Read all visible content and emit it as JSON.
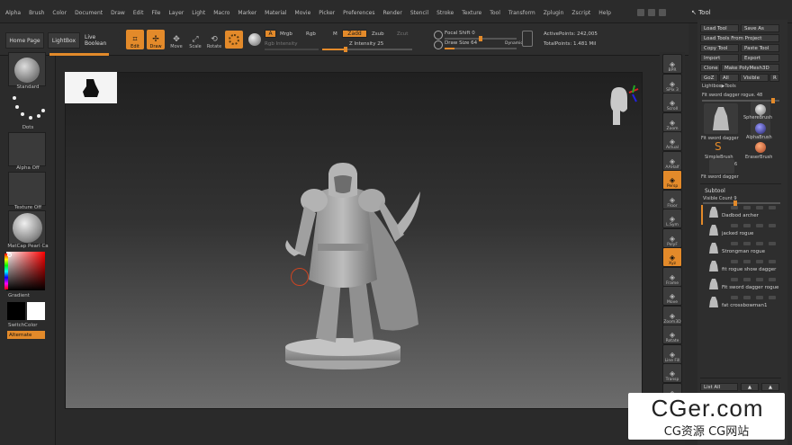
{
  "menu": {
    "items": [
      "Alpha",
      "Brush",
      "Color",
      "Document",
      "Draw",
      "Edit",
      "File",
      "Layer",
      "Light",
      "Macro",
      "Marker",
      "Material",
      "Movie",
      "Picker",
      "Preferences",
      "Render",
      "Stencil",
      "Stroke",
      "Texture",
      "Tool",
      "Transform",
      "Zplugin",
      "Zscript",
      "Help"
    ]
  },
  "tool_palette_title": "Tool",
  "shelf": {
    "home_page": "Home Page",
    "lightbox": "LightBox",
    "live_boolean": "Live Boolean",
    "edit": "Edit",
    "draw": "Draw",
    "move": "Move",
    "scale": "Scale",
    "rotate": "Rotate",
    "a_label": "A",
    "mrgb": "Mrgb",
    "rgb": "Rgb",
    "m": "M",
    "zadd": "Zadd",
    "zsub": "Zsub",
    "zcut": "Zcut",
    "rgb_intensity": "Rgb Intensity",
    "z_intensity": "Z Intensity 25",
    "z_intensity_value": 0.25,
    "focal_shift": "Focal Shift 0",
    "draw_size": "Draw Size 64",
    "dynamic": "Dynamic",
    "active_points": "ActivePoints: 242,005",
    "total_points": "TotalPoints: 1.481 Mil"
  },
  "left_tray": {
    "standard": "Standard",
    "dots": "Dots",
    "alpha_off": "Alpha Off",
    "texture_off": "Texture Off",
    "matcap": "MatCap Pearl Ca",
    "gradient": "Gradient",
    "switch_color": "SwitchColor",
    "alternate": "Alternate"
  },
  "right_shelf": [
    "BPR",
    "SPix 3",
    "Scroll",
    "Zoom",
    "Actual",
    "AAHalf",
    "Persp",
    "Floor",
    "L.Sym",
    "PolyF",
    "Xyz",
    "Frame",
    "Move",
    "Zoom3D",
    "Rotate",
    "Line Fill",
    "Transp",
    "Solo"
  ],
  "tool_panel": {
    "load_tool": "Load Tool",
    "save_as": "Save As",
    "load_from_project": "Load Tools From Project",
    "copy_tool": "Copy Tool",
    "paste_tool": "Paste Tool",
    "import": "Import",
    "export": "Export",
    "clone": "Clone",
    "make_polymesh": "Make PolyMesh3D",
    "goz": "GoZ",
    "all": "All",
    "visible": "Visible",
    "visible_r": "R",
    "lightbox_tools": "Lightbox▶Tools",
    "current_tool": "Fit sword dagger rogue. 48",
    "thumb_labels": [
      "Fit sword dagger",
      "SphereBrush",
      "AlphaBrush",
      "SimpleBrush",
      "EraserBrush",
      "Fit sword dagger"
    ],
    "thumb_count": "6",
    "subtool_header": "Subtool",
    "visible_count": "Visible Count 9",
    "subtools": [
      "Dadbod archer",
      "jacked rogue",
      "Strongman rogue",
      "fit rogue show dagger",
      "Fit sword dagger rogue",
      "fat crossbowman1"
    ],
    "list_all": "List All"
  },
  "watermark": {
    "title": "CGer.com",
    "subtitle": "CG资源 CG网站"
  }
}
